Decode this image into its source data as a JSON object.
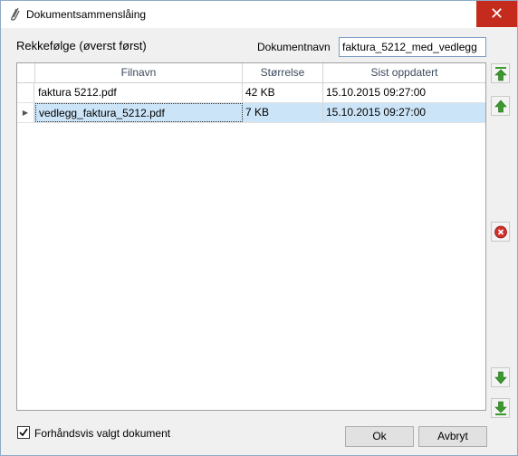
{
  "window": {
    "title": "Dokumentsammenslåing",
    "close_glyph": "✕"
  },
  "header": {
    "order_label": "Rekkefølge (øverst først)",
    "docname_label": "Dokumentnavn",
    "docname_value": "faktura_5212_med_vedlegg"
  },
  "grid": {
    "columns": [
      "Filnavn",
      "Størrelse",
      "Sist oppdatert"
    ],
    "rows": [
      {
        "filename": "faktura 5212.pdf",
        "size": "42 KB",
        "updated": "15.10.2015 09:27:00",
        "selected": false,
        "row_marker": ""
      },
      {
        "filename": "vedlegg_faktura_5212.pdf",
        "size": "7 KB",
        "updated": "15.10.2015 09:27:00",
        "selected": true,
        "row_marker": "▶"
      }
    ]
  },
  "side_buttons": {
    "move_top": "move-to-top-icon",
    "move_up": "move-up-icon",
    "remove": "remove-icon",
    "move_down": "move-down-icon",
    "move_bottom": "move-to-bottom-icon"
  },
  "footer": {
    "preview_checked": true,
    "preview_label": "Forhåndsvis valgt dokument",
    "ok_label": "Ok",
    "cancel_label": "Avbryt"
  },
  "colors": {
    "accent_green": "#3a9a2c",
    "remove_red": "#d0302a",
    "selection": "#cce4f7",
    "close_red": "#c42b1c"
  }
}
